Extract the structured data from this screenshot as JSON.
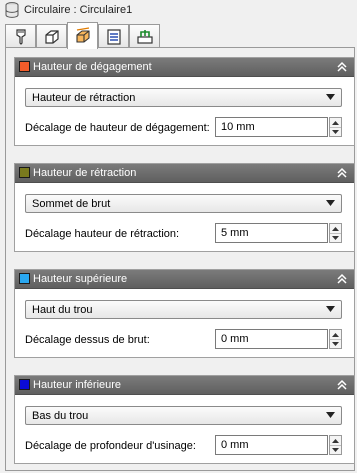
{
  "window": {
    "title": "Circulaire : Circulaire1",
    "icon": "database-icon"
  },
  "tabs": [
    {
      "icon": "tool-icon",
      "active": false
    },
    {
      "icon": "stock-box-icon",
      "active": false
    },
    {
      "icon": "heights-icon",
      "active": true
    },
    {
      "icon": "passes-icon",
      "active": false
    },
    {
      "icon": "linking-icon",
      "active": false
    }
  ],
  "sections": [
    {
      "title": "Hauteur de dégagement",
      "swatch_color": "#f25c2a",
      "dropdown_value": "Hauteur de rétraction",
      "offset_label": "Décalage de hauteur de dégagement:",
      "offset_value": "10 mm"
    },
    {
      "title": "Hauteur de rétraction",
      "swatch_color": "#7a7a1e",
      "dropdown_value": "Sommet de brut",
      "offset_label": "Décalage hauteur de rétraction:",
      "offset_value": "5 mm"
    },
    {
      "title": "Hauteur supérieure",
      "swatch_color": "#29a7f0",
      "dropdown_value": "Haut du trou",
      "offset_label": "Décalage dessus de brut:",
      "offset_value": "0 mm"
    },
    {
      "title": "Hauteur inférieure",
      "swatch_color": "#0b0bd6",
      "dropdown_value": "Bas du trou",
      "offset_label": "Décalage de profondeur d'usinage:",
      "offset_value": "0 mm"
    }
  ]
}
